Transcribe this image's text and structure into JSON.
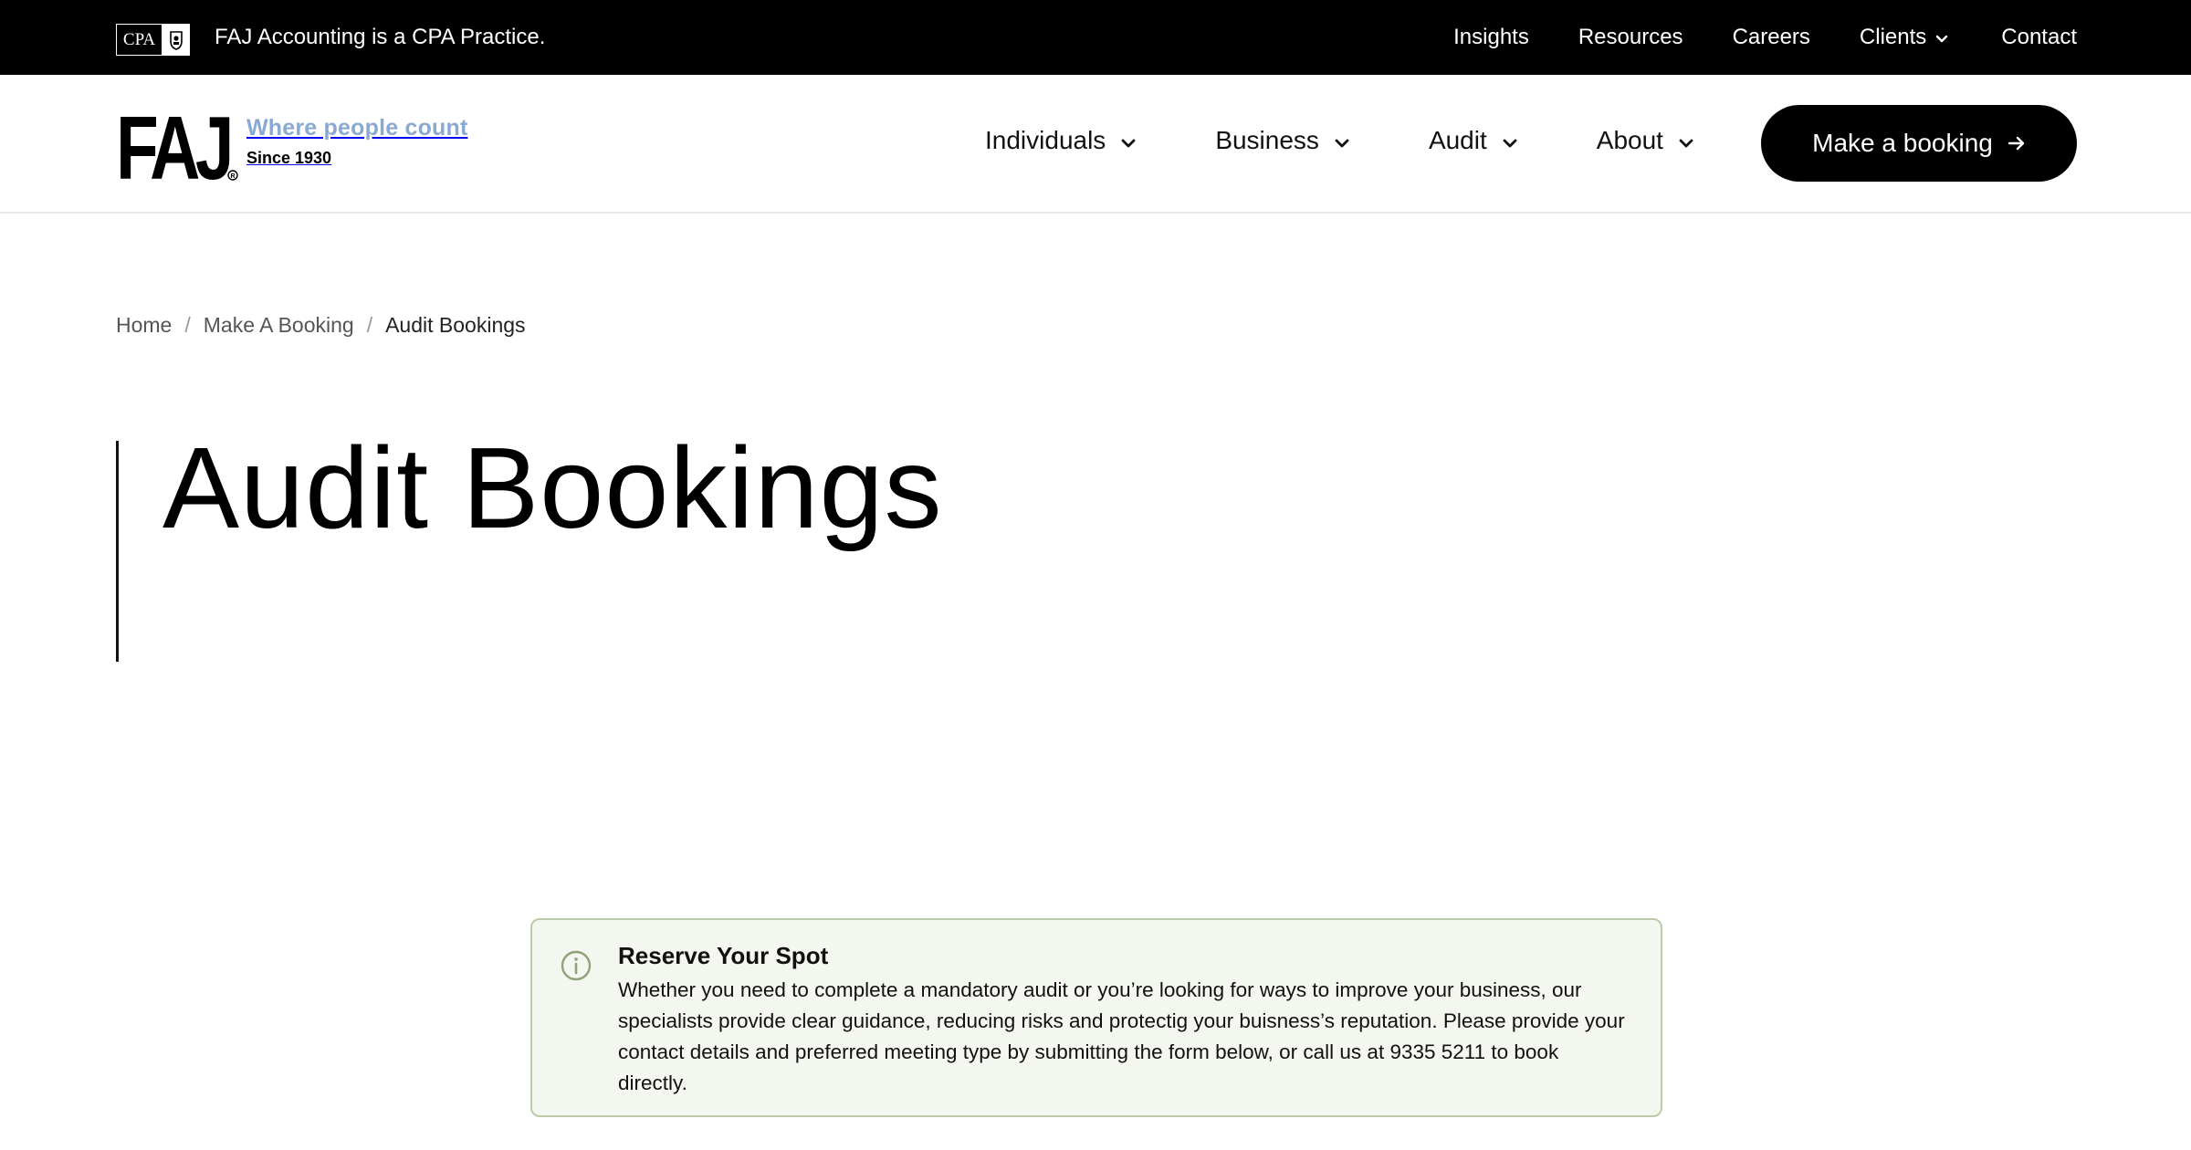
{
  "topbar": {
    "cpa_logo_text": "CPA",
    "tagline": "FAJ Accounting is a CPA Practice.",
    "nav": [
      {
        "label": "Insights"
      },
      {
        "label": "Resources"
      },
      {
        "label": "Careers"
      },
      {
        "label": "Clients",
        "has_dropdown": true
      },
      {
        "label": "Contact"
      }
    ]
  },
  "header": {
    "brand_mark": "FAJ",
    "brand_tagline": "Where people count",
    "brand_since": "Since 1930",
    "nav": [
      {
        "label": "Individuals",
        "has_dropdown": true
      },
      {
        "label": "Business",
        "has_dropdown": true
      },
      {
        "label": "Audit",
        "has_dropdown": true
      },
      {
        "label": "About",
        "has_dropdown": true
      }
    ],
    "cta_label": "Make a booking"
  },
  "breadcrumb": {
    "items": [
      "Home",
      "Make A Booking"
    ],
    "current": "Audit Bookings",
    "separator": "/"
  },
  "page": {
    "title": "Audit Bookings"
  },
  "notice": {
    "icon": "info-icon",
    "title": "Reserve Your Spot",
    "body": "Whether you need to complete a mandatory audit or you’re looking for ways to improve your business, our specialists provide clear guidance, reducing risks and protectig your buisness’s reputation. Please provide your contact details and preferred meeting type by submitting the form below, or call us at 9335 5211 to book directly."
  },
  "colors": {
    "topbar_bg": "#000000",
    "brand_tagline": "#8aa9d1",
    "notice_bg": "#f4f6f0",
    "notice_border": "#bccaa9"
  }
}
